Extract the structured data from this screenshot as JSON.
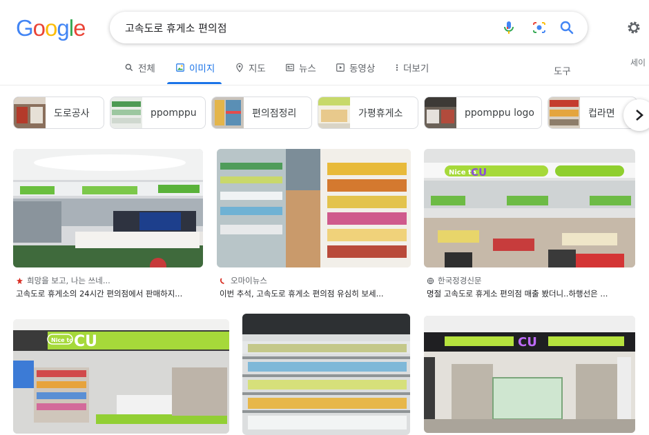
{
  "logo": {
    "letters": [
      "G",
      "o",
      "o",
      "g",
      "l",
      "e"
    ],
    "colors": [
      "#4285f4",
      "#ea4335",
      "#fbbc05",
      "#4285f4",
      "#34a853",
      "#ea4335"
    ]
  },
  "search": {
    "query": "고속도로 휴게소 편의점"
  },
  "tabs": [
    {
      "label": "전체",
      "icon": "search-icon"
    },
    {
      "label": "이미지",
      "icon": "image-icon",
      "active": true
    },
    {
      "label": "지도",
      "icon": "map-pin-icon"
    },
    {
      "label": "뉴스",
      "icon": "newspaper-icon"
    },
    {
      "label": "동영상",
      "icon": "play-icon"
    },
    {
      "label": "더보기",
      "icon": "more-vert-icon"
    }
  ],
  "tools_label": "도구",
  "sign_in_label": "세이",
  "chips": [
    {
      "label": "도로공사"
    },
    {
      "label": "ppomppu"
    },
    {
      "label": "편의점정리"
    },
    {
      "label": "가평휴게소"
    },
    {
      "label": "ppomppu logo"
    },
    {
      "label": "컵라면"
    }
  ],
  "results": [
    {
      "source": "희망을 보고, 나는 쓰네...",
      "title": "고속도로 휴게소의 24시간 편의점에서 판매하지...",
      "source_icon": "red-star-icon"
    },
    {
      "source": "오마이뉴스",
      "title": "이번 추석, 고속도로 휴게소 편의점 유심히 보세...",
      "source_icon": "ohmynews-icon"
    },
    {
      "source": "한국정경신문",
      "title": "명절 고속도로 휴게소 편의점 매출 봤더니..하행선은 ...",
      "source_icon": "globe-icon"
    },
    {
      "source": "",
      "title": ""
    },
    {
      "source": "",
      "title": ""
    },
    {
      "source": "",
      "title": ""
    }
  ],
  "store_signs": {
    "nice_to": "Nice to",
    "cu": "CU"
  },
  "colors": {
    "accent": "#1a73e8",
    "cu_green": "#a6d93a",
    "cu_purple": "#8a4fd8"
  }
}
